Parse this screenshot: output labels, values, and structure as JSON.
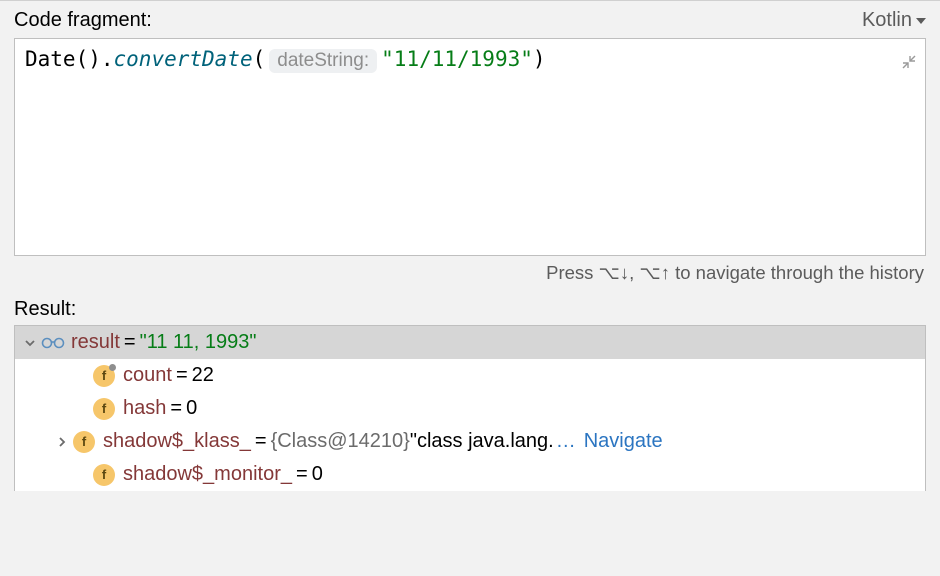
{
  "header": {
    "label": "Code fragment:",
    "language": "Kotlin"
  },
  "code": {
    "prefix": "Date().",
    "method": "convertDate",
    "open": "(",
    "paramHint": "dateString:",
    "string": "\"11/11/1993\"",
    "close": ")"
  },
  "hint": "Press ⌥↓, ⌥↑ to navigate through the history",
  "result": {
    "label": "Result:",
    "rows": [
      {
        "name": "result",
        "valueString": "\"11 11, 1993\""
      },
      {
        "name": "count",
        "valueNum": "22"
      },
      {
        "name": "hash",
        "valueNum": "0"
      },
      {
        "name": "shadow$_klass_",
        "valueObj": "{Class@14210}",
        "valueText": " \"class java.lang.",
        "navigate": "Navigate"
      },
      {
        "name": "shadow$_monitor_",
        "valueNum": "0"
      }
    ]
  },
  "icons": {
    "fieldLetter": "f"
  }
}
